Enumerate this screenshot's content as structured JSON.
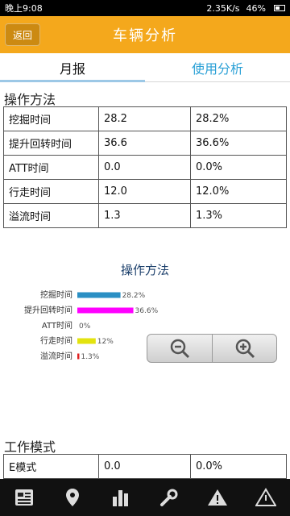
{
  "status_bar": {
    "time": "晚上9:08",
    "speed": "2.35K/s",
    "battery": "46%"
  },
  "header": {
    "back_label": "返回",
    "title": "车辆分析"
  },
  "tabs": [
    {
      "label": "月报"
    },
    {
      "label": "使用分析"
    }
  ],
  "operation_section": {
    "title": "操作方法",
    "rows": [
      {
        "name": "挖掘时间",
        "value": "28.2",
        "percent": "28.2%"
      },
      {
        "name": "提升回转时间",
        "value": "36.6",
        "percent": "36.6%"
      },
      {
        "name": "ATT时间",
        "value": "0.0",
        "percent": "0.0%"
      },
      {
        "name": "行走时间",
        "value": "12.0",
        "percent": "12.0%"
      },
      {
        "name": "溢流时间",
        "value": "1.3",
        "percent": "1.3%"
      }
    ]
  },
  "chart_data": {
    "type": "bar",
    "orientation": "horizontal",
    "title": "操作方法",
    "categories": [
      "挖掘时间",
      "提升回转时间",
      "ATT时间",
      "行走时间",
      "溢流时间"
    ],
    "values": [
      28.2,
      36.6,
      0.0,
      12.0,
      1.3
    ],
    "labels": [
      "28.2%",
      "36.6%",
      "0%",
      "12%",
      "1.3%"
    ],
    "colors": [
      "#2a8fc4",
      "#ff00ff",
      "#888888",
      "#e3e30f",
      "#e02020"
    ],
    "xlim": [
      0,
      100
    ],
    "grid": false,
    "legend": "none"
  },
  "work_mode_section": {
    "title": "工作模式",
    "rows": [
      {
        "name": "E模式",
        "value": "0.0",
        "percent": "0.0%"
      }
    ]
  },
  "bottom_nav": [
    {
      "icon": "report-icon"
    },
    {
      "icon": "location-pin-icon"
    },
    {
      "icon": "bar-chart-icon"
    },
    {
      "icon": "wrench-icon"
    },
    {
      "icon": "warning-icon"
    },
    {
      "icon": "alert-icon"
    }
  ]
}
